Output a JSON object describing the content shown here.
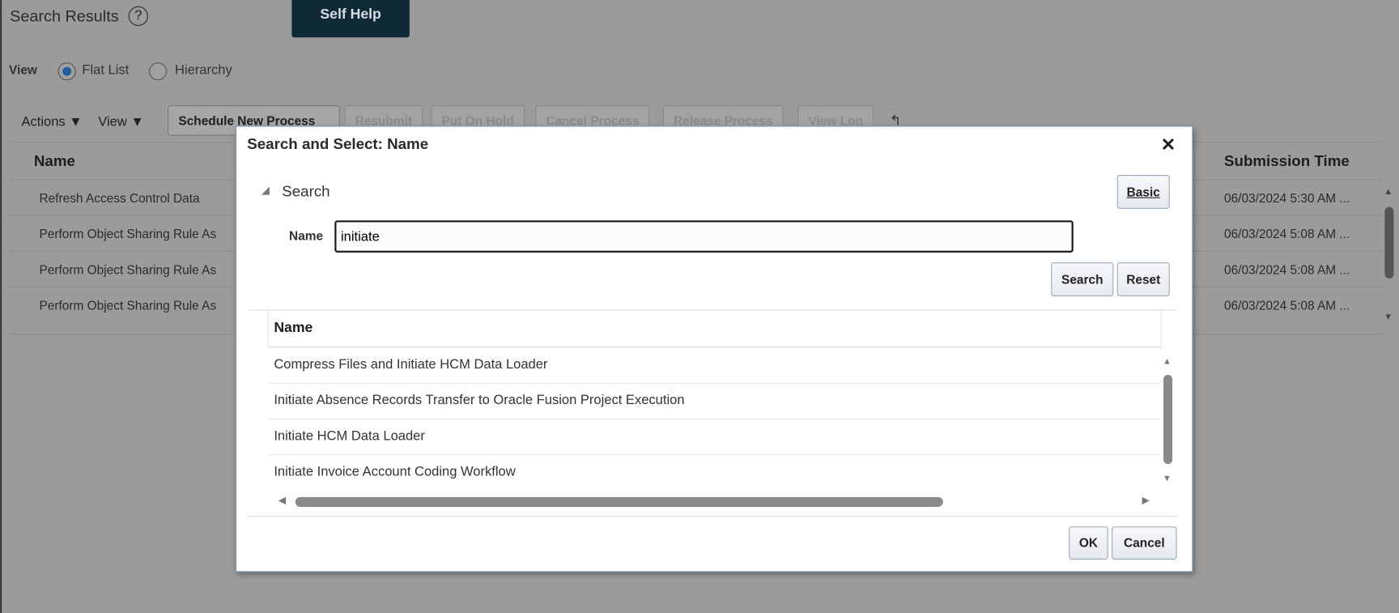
{
  "page": {
    "title": "Search Results",
    "self_help": "Self Help",
    "view_label": "View",
    "view_options": [
      "Flat List",
      "Hierarchy"
    ],
    "selected_view": "Flat List"
  },
  "toolbar": {
    "actions": "Actions",
    "view": "View",
    "buttons": [
      "Schedule New Process",
      "Resubmit",
      "Put On Hold",
      "Cancel Process",
      "Release Process",
      "View Log"
    ]
  },
  "grid": {
    "columns": [
      "Name",
      "Submission Time"
    ],
    "rows": [
      {
        "name": "Refresh Access Control Data",
        "time": "06/03/2024 5:30 AM ..."
      },
      {
        "name": "Perform Object Sharing Rule As",
        "time": "06/03/2024 5:08 AM ..."
      },
      {
        "name": "Perform Object Sharing Rule As",
        "time": "06/03/2024 5:08 AM ..."
      },
      {
        "name": "Perform Object Sharing Rule As",
        "time": "06/03/2024 5:08 AM ..."
      }
    ]
  },
  "dialog": {
    "title": "Search and Select: Name",
    "close": "✕",
    "search_section": "Search",
    "basic": "Basic",
    "name_label": "Name",
    "name_value": "initiate",
    "search_btn": "Search",
    "reset_btn": "Reset",
    "results_header": "Name",
    "results": [
      "Compress Files and Initiate HCM Data Loader",
      "Initiate Absence Records Transfer to Oracle Fusion Project Execution",
      "Initiate HCM Data Loader",
      "Initiate Invoice Account Coding Workflow"
    ],
    "ok": "OK",
    "cancel": "Cancel"
  }
}
